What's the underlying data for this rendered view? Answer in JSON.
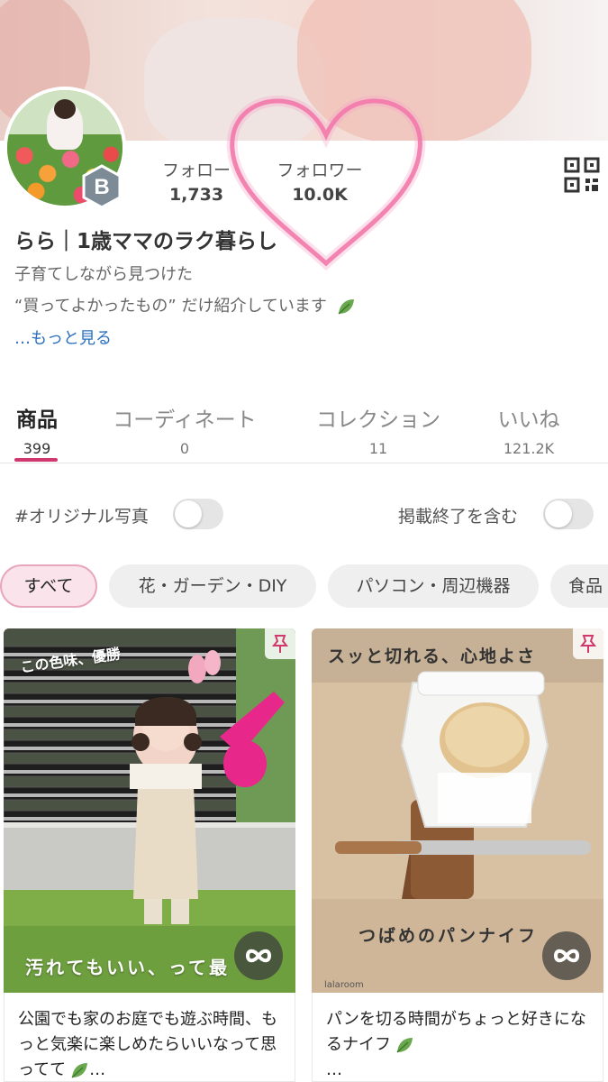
{
  "profile": {
    "name": "らら｜1歳ママのラク暮らし",
    "bio_line1": "子育てしながら見つけた",
    "bio_line2": "“買ってよかったもの” だけ紹介しています",
    "more_link": "…もっと見る",
    "badge_letter": "B"
  },
  "stats": {
    "follow_label": "フォロー",
    "follow_count": "1,733",
    "follower_label": "フォロワー",
    "follower_count": "10.0K"
  },
  "tabs": [
    {
      "label": "商品",
      "count": "399",
      "active": true
    },
    {
      "label": "コーディネート",
      "count": "0"
    },
    {
      "label": "コレクション",
      "count": "11"
    },
    {
      "label": "いいね",
      "count": "121.2K"
    }
  ],
  "filters": {
    "original_photo_label": "#オリジナル写真",
    "original_photo_on": false,
    "include_ended_label": "掲載終了を含む",
    "include_ended_on": false
  },
  "chips": [
    "すべて",
    "花・ガーデン・DIY",
    "パソコン・周辺機器",
    "食品"
  ],
  "cards": [
    {
      "caption": "公園でも家のお庭でも遊ぶ時間、もっと気楽に楽しめたらいいなって思ってて",
      "caption_tail": "…",
      "img_top_text": "この色味、優勝",
      "img_bottom_text": "汚れてもいい、って最"
    },
    {
      "caption": "パンを切る時間がちょっと好きになるナイフ",
      "caption_tail": "…",
      "img_top_text": "スッと切れる、心地よさ",
      "img_bottom_text": "つばめのパンナイフ",
      "watermark": "lalaroom"
    }
  ],
  "colors": {
    "accent_pink": "#d1386e",
    "link_blue": "#2a6fbf",
    "heart_pink": "#f0609a"
  },
  "icons": [
    "qr-code-icon",
    "leaf-icon",
    "pin-icon",
    "loop-icon",
    "heart-overlay"
  ]
}
